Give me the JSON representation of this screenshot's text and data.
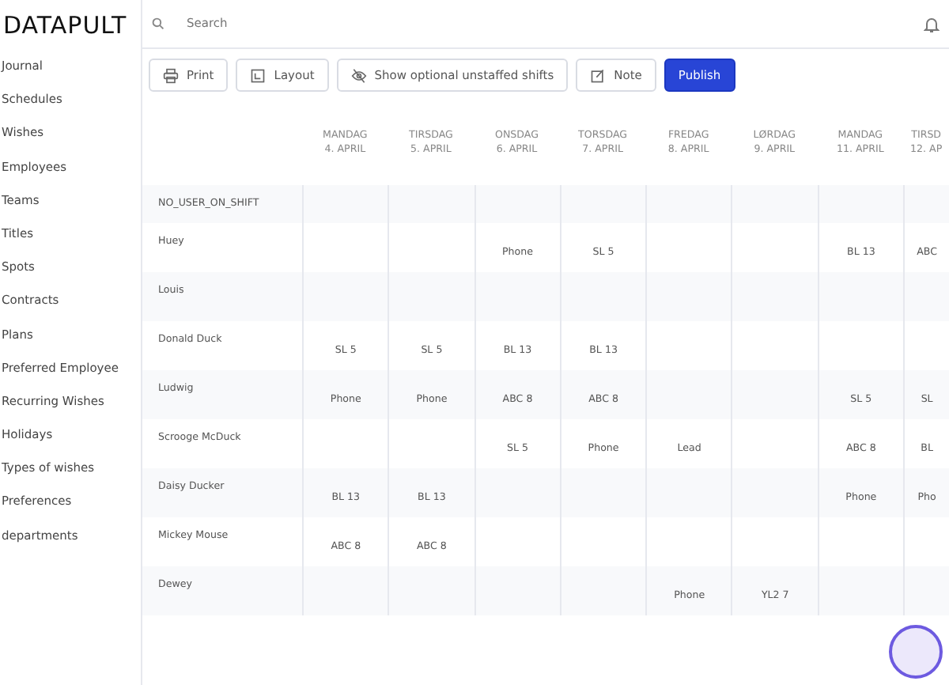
{
  "sidebar": {
    "logo": "DATAPULT",
    "items": [
      "Journal",
      "Schedules",
      "Wishes",
      "Employees",
      "Teams",
      "Titles",
      "Spots",
      "Contracts",
      "Plans",
      "Preferred Employee",
      "Recurring Wishes",
      "Holidays",
      "Types of wishes",
      "Preferences",
      "departments"
    ]
  },
  "search": {
    "placeholder": "Search"
  },
  "toolbar": [
    {
      "kind": "print",
      "label": "Print"
    },
    {
      "kind": "layout",
      "label": "Layout"
    },
    {
      "kind": "hide",
      "label": "Show optional unstaffed shifts"
    },
    {
      "kind": "note",
      "label": "Note"
    },
    {
      "kind": "primary",
      "label": "Publish"
    }
  ],
  "table": {
    "columns": [
      {
        "day": "MANDAG",
        "date": "4. APRIL"
      },
      {
        "day": "TIRSDAG",
        "date": "5. APRIL"
      },
      {
        "day": "ONSDAG",
        "date": "6. APRIL"
      },
      {
        "day": "TORSDAG",
        "date": "7. APRIL"
      },
      {
        "day": "FREDAG",
        "date": "8. APRIL"
      },
      {
        "day": "LØRDAG",
        "date": "9. APRIL"
      },
      {
        "day": "MANDAG",
        "date": "11. APRIL"
      },
      {
        "day": "TIRSD",
        "date": "12. AP"
      }
    ],
    "rows": [
      {
        "name": "NO_USER_ON_SHIFT",
        "cells": [
          "",
          "",
          "",
          "",
          "",
          "",
          "",
          ""
        ]
      },
      {
        "name": "Huey",
        "cells": [
          "",
          "",
          "Phone",
          "SL 5",
          "",
          "",
          "BL 13",
          "ABC"
        ]
      },
      {
        "name": "Louis",
        "cells": [
          "",
          "",
          "",
          "",
          "",
          "",
          "",
          ""
        ]
      },
      {
        "name": "Donald Duck",
        "cells": [
          "SL 5",
          "SL 5",
          "BL 13",
          "BL 13",
          "",
          "",
          "",
          ""
        ]
      },
      {
        "name": "Ludwig",
        "cells": [
          "Phone",
          "Phone",
          "ABC 8",
          "ABC 8",
          "",
          "",
          "SL 5",
          "SL"
        ]
      },
      {
        "name": "Scrooge McDuck",
        "cells": [
          "",
          "",
          "SL 5",
          "Phone",
          "Lead",
          "",
          "ABC 8",
          "BL"
        ]
      },
      {
        "name": "Daisy Ducker",
        "cells": [
          "BL 13",
          "BL 13",
          "",
          "",
          "",
          "",
          "Phone",
          "Pho"
        ]
      },
      {
        "name": "Mickey Mouse",
        "cells": [
          "ABC 8",
          "ABC 8",
          "",
          "",
          "",
          "",
          "",
          ""
        ]
      },
      {
        "name": "Dewey",
        "cells": [
          "",
          "",
          "",
          "",
          "Phone",
          "YL2 7",
          "",
          ""
        ]
      }
    ]
  }
}
